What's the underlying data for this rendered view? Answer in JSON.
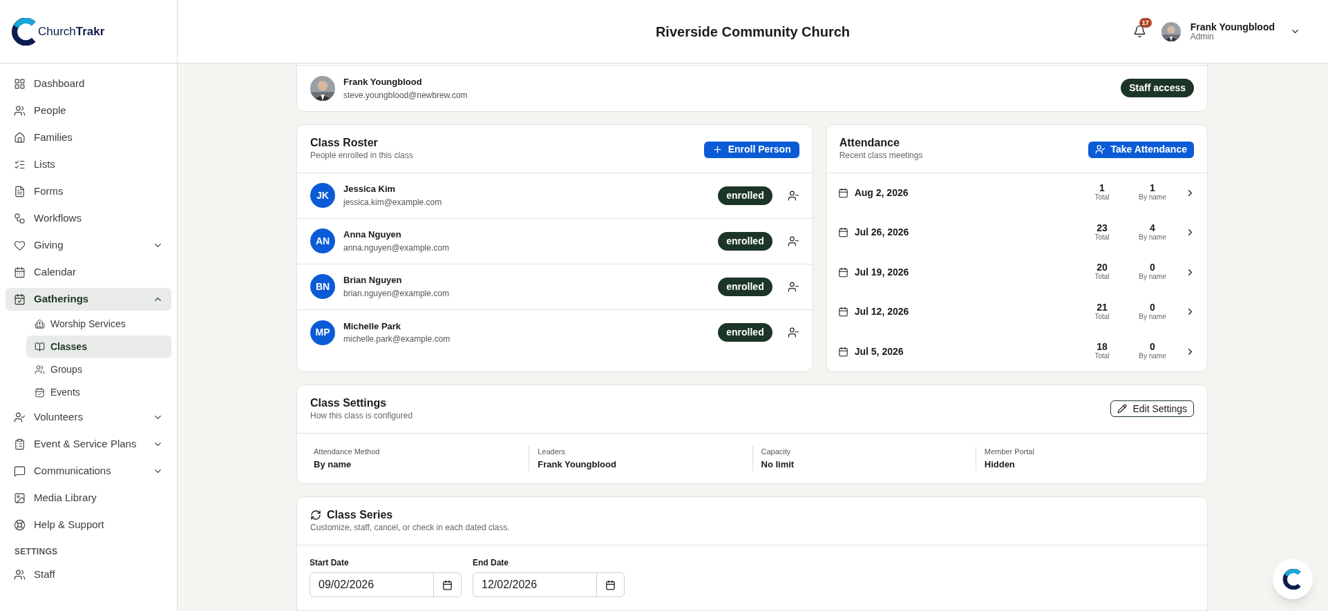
{
  "brand": {
    "name": "Church**Trakr**"
  },
  "sidebar": {
    "items": [
      {
        "label": "Dashboard",
        "selected": false
      },
      {
        "label": "People",
        "selected": false
      },
      {
        "label": "Families",
        "selected": false
      },
      {
        "label": "Lists",
        "selected": false
      },
      {
        "label": "Forms",
        "selected": false
      },
      {
        "label": "Workflows",
        "selected": false
      },
      {
        "label": "Giving",
        "selected": false,
        "expanded": false
      },
      {
        "label": "Calendar",
        "selected": false
      },
      {
        "label": "Gatherings",
        "selected": true,
        "expanded": true,
        "children": [
          {
            "label": "Worship Services",
            "selected": false
          },
          {
            "label": "Classes",
            "selected": true
          },
          {
            "label": "Groups",
            "selected": false
          },
          {
            "label": "Events",
            "selected": false
          }
        ]
      },
      {
        "label": "Volunteers",
        "selected": false,
        "expanded": false
      },
      {
        "label": "Event & Service Plans",
        "selected": false,
        "expanded": false
      },
      {
        "label": "Communications",
        "selected": false,
        "expanded": false
      },
      {
        "label": "Media Library",
        "selected": false
      },
      {
        "label": "Help & Support",
        "selected": false
      }
    ],
    "sections": [
      {
        "heading": "SETTINGS",
        "items": [
          {
            "label": "Staff",
            "selected": false
          }
        ]
      }
    ]
  },
  "header": {
    "title": "Riverside Community Church",
    "notification_count": "17",
    "user": {
      "name": "Frank Youngblood",
      "role": "Admin"
    }
  },
  "managers": {
    "people": [
      {
        "name": "Frank Youngblood",
        "email": "steve.youngblood@newbrew.com",
        "badge": "Staff access"
      }
    ]
  },
  "roster": {
    "title": "Class Roster",
    "subtitle": "People enrolled in this class",
    "button": "Enroll Person",
    "rows": [
      {
        "initials": "JK",
        "name": "Jessica Kim",
        "email": "jessica.kim@example.com",
        "status": "enrolled"
      },
      {
        "initials": "AN",
        "name": "Anna Nguyen",
        "email": "anna.nguyen@example.com",
        "status": "enrolled"
      },
      {
        "initials": "BN",
        "name": "Brian Nguyen",
        "email": "brian.nguyen@example.com",
        "status": "enrolled"
      },
      {
        "initials": "MP",
        "name": "Michelle Park",
        "email": "michelle.park@example.com",
        "status": "enrolled"
      }
    ]
  },
  "attendance": {
    "title": "Attendance",
    "subtitle": "Recent class meetings",
    "button": "Take Attendance",
    "meetings": [
      {
        "date": "Aug 2, 2026",
        "total": "1",
        "total_label": "Total",
        "by_name": "1",
        "by_name_label": "By name"
      },
      {
        "date": "Jul 26, 2026",
        "total": "23",
        "total_label": "Total",
        "by_name": "4",
        "by_name_label": "By name"
      },
      {
        "date": "Jul 19, 2026",
        "total": "20",
        "total_label": "Total",
        "by_name": "0",
        "by_name_label": "By name"
      },
      {
        "date": "Jul 12, 2026",
        "total": "21",
        "total_label": "Total",
        "by_name": "0",
        "by_name_label": "By name"
      },
      {
        "date": "Jul 5, 2026",
        "total": "18",
        "total_label": "Total",
        "by_name": "0",
        "by_name_label": "By name"
      }
    ]
  },
  "settings": {
    "title": "Class Settings",
    "subtitle": "How this class is configured",
    "button": "Edit Settings",
    "fields": [
      {
        "label": "Attendance Method",
        "value": "By name"
      },
      {
        "label": "Leaders",
        "value": "Frank Youngblood"
      },
      {
        "label": "Capacity",
        "value": "No limit"
      },
      {
        "label": "Member Portal",
        "value": "Hidden"
      }
    ]
  },
  "series": {
    "title": "Class Series",
    "subtitle": "Customize, staff, cancel, or check in each dated class.",
    "dates": [
      {
        "label": "Start Date",
        "value": "09/02/2026"
      },
      {
        "label": "End Date",
        "value": "12/02/2026"
      }
    ]
  }
}
